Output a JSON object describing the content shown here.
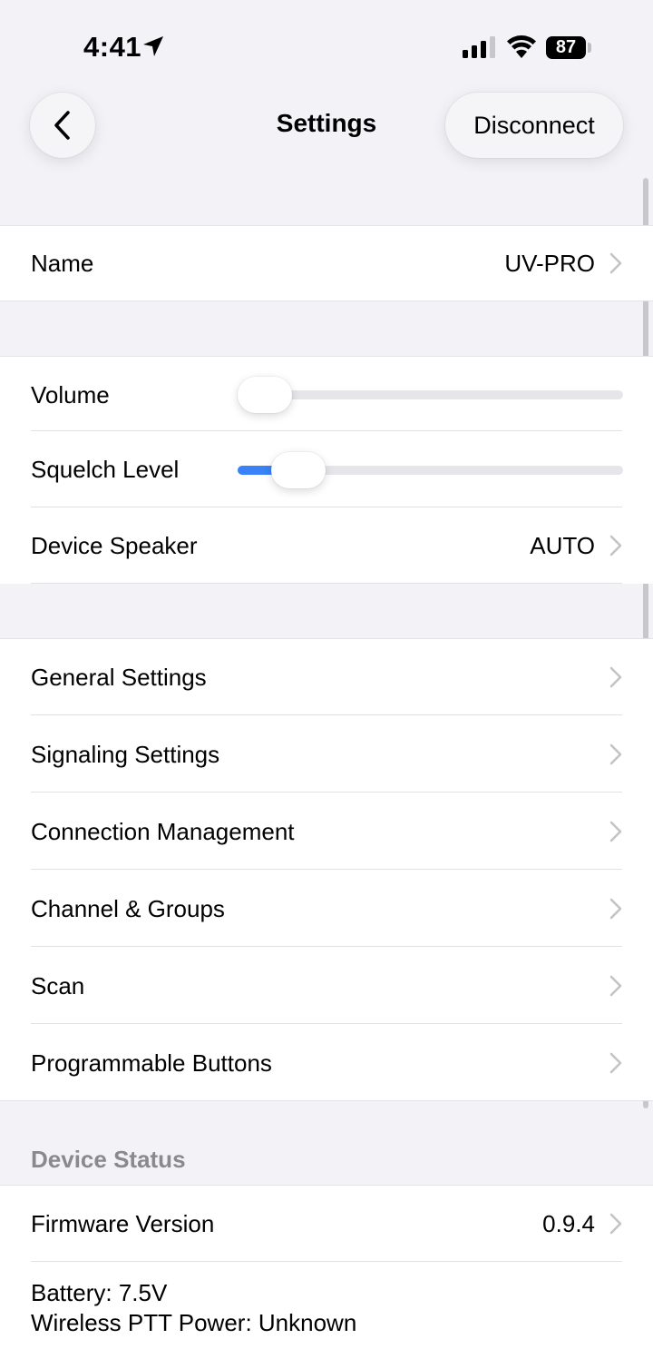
{
  "status_bar": {
    "time": "4:41",
    "battery_percent": "87"
  },
  "nav": {
    "title": "Settings",
    "disconnect_label": "Disconnect"
  },
  "device": {
    "name_label": "Name",
    "name_value": "UV-PRO"
  },
  "audio": {
    "volume_label": "Volume",
    "volume_level": 0.0,
    "squelch_label": "Squelch Level",
    "squelch_level": 0.1,
    "speaker_label": "Device Speaker",
    "speaker_value": "AUTO"
  },
  "menu": {
    "items": [
      {
        "label": "General Settings"
      },
      {
        "label": "Signaling Settings"
      },
      {
        "label": "Connection Management"
      },
      {
        "label": "Channel & Groups"
      },
      {
        "label": "Scan"
      },
      {
        "label": "Programmable Buttons"
      }
    ]
  },
  "status_section": {
    "header": "Device Status",
    "firmware_label": "Firmware Version",
    "firmware_value": "0.9.4",
    "battery_line": "Battery: 7.5V",
    "ptt_line": "Wireless PTT Power: Unknown"
  },
  "colors": {
    "accent": "#3a82f7",
    "background": "#f2f2f7",
    "section_header": "#8a8a8e"
  },
  "icons": [
    "location-arrow-icon",
    "cellular-signal-icon",
    "wifi-icon",
    "battery-icon",
    "back-chevron-icon",
    "chevron-right-icon"
  ]
}
